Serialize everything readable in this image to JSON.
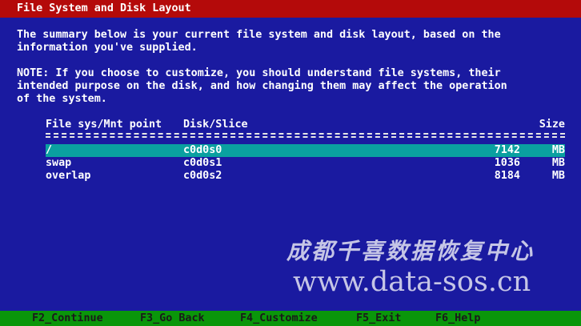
{
  "title": "File System and Disk Layout",
  "summary_lines": [
    "The summary below is your current file system and disk layout, based on the",
    "information you've supplied."
  ],
  "note_lines": [
    "NOTE: If you choose to customize, you should understand file systems, their",
    "intended purpose on the disk, and how changing them may affect the operation",
    "of the system."
  ],
  "table": {
    "headers": {
      "fs": "File sys/Mnt point",
      "disk": "Disk/Slice",
      "size": "Size"
    },
    "rows": [
      {
        "fs": "/",
        "disk": "c0d0s0",
        "size": "7142",
        "unit": "MB",
        "selected": true
      },
      {
        "fs": "swap",
        "disk": "c0d0s1",
        "size": "1036",
        "unit": "MB",
        "selected": false
      },
      {
        "fs": "overlap",
        "disk": "c0d0s2",
        "size": "8184",
        "unit": "MB",
        "selected": false
      }
    ]
  },
  "watermark": {
    "chinese": "成都千喜数据恢复中心",
    "url": "www.data-sos.cn"
  },
  "footer_keys": {
    "f2": "F2_Continue",
    "f3": "F3_Go Back",
    "f4": "F4_Customize",
    "f5": "F5_Exit",
    "f6": "F6_Help"
  },
  "colors": {
    "background": "#1a1aa0",
    "title_bar": "#b40a0a",
    "selected_row": "#0aa0a0",
    "footer_bar": "#0a960a"
  }
}
